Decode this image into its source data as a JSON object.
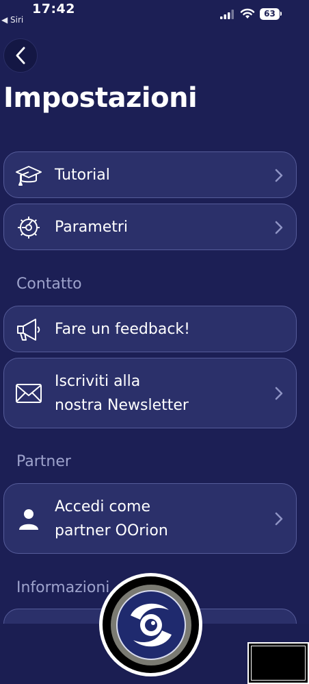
{
  "status_bar": {
    "time": "17:42",
    "back_app": "◀ Siri",
    "battery": "63"
  },
  "page": {
    "title": "Impostazioni"
  },
  "items": {
    "tutorial": {
      "label": "Tutorial",
      "icon": "graduation-cap-icon"
    },
    "parametri": {
      "label": "Parametri",
      "icon": "gear-icon"
    },
    "feedback": {
      "label": "Fare un feedback!",
      "icon": "megaphone-icon"
    },
    "newsletter": {
      "label_line1": "Iscriviti alla",
      "label_line2": "nostra Newsletter",
      "icon": "mail-icon"
    },
    "partner": {
      "label_line1": "Accedi come",
      "label_line2": "partner OOrion",
      "icon": "person-icon"
    }
  },
  "sections": {
    "contatto": "Contatto",
    "partner": "Partner",
    "informazioni": "Informazioni"
  },
  "colors": {
    "background": "#1c1f55",
    "row": "#2b306a",
    "row_border": "#565c9a",
    "section_text": "#9ea3cc"
  }
}
